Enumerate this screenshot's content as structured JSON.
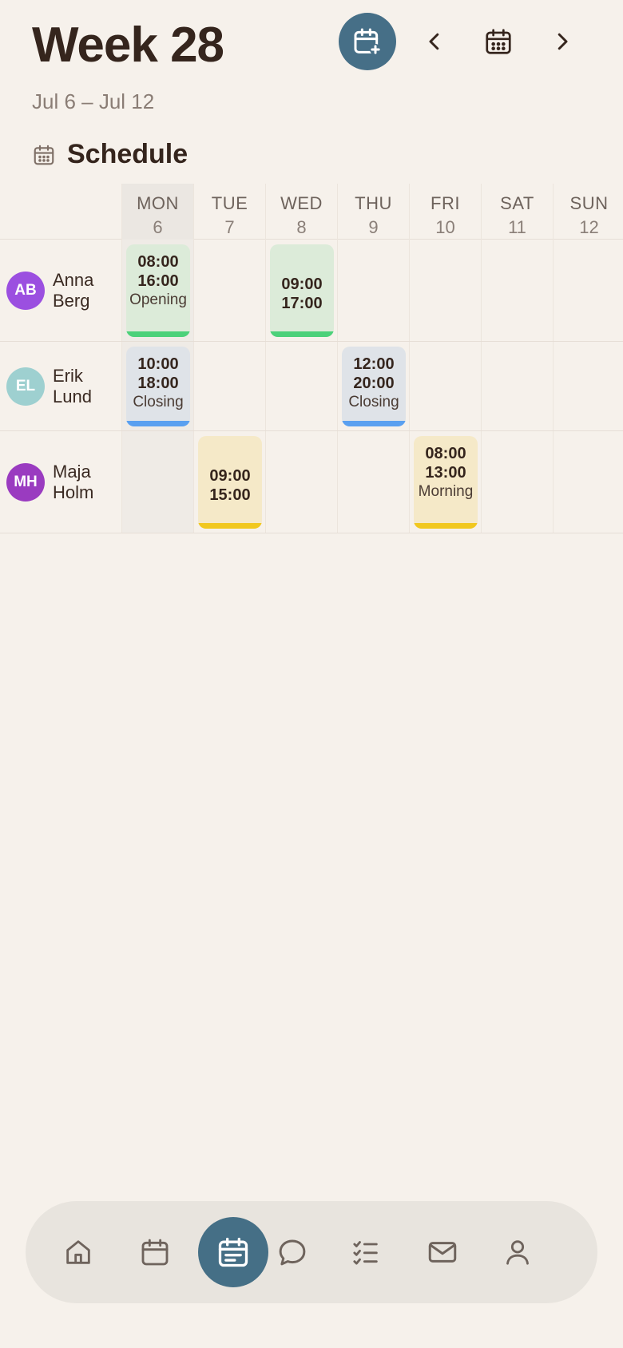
{
  "header": {
    "title": "Week 28",
    "range": "Jul 6 – Jul 12"
  },
  "actions": [
    "add-shift-icon",
    "chevron-left-icon",
    "calendar-icon",
    "chevron-right-icon"
  ],
  "section": {
    "title": "Schedule",
    "icon": "calendar-icon"
  },
  "days": [
    {
      "name": "MON",
      "num": "6",
      "active": true
    },
    {
      "name": "TUE",
      "num": "7",
      "active": false
    },
    {
      "name": "WED",
      "num": "8",
      "active": false
    },
    {
      "name": "THU",
      "num": "9",
      "active": false
    },
    {
      "name": "FRI",
      "num": "10",
      "active": false
    },
    {
      "name": "SAT",
      "num": "11",
      "active": false
    },
    {
      "name": "SUN",
      "num": "12",
      "active": false
    }
  ],
  "people": [
    {
      "initials": "AB",
      "first": "Anna",
      "last": "Berg",
      "avatar_color": "#9b4fe0",
      "shifts": [
        {
          "day": 0,
          "start": "08:00",
          "end": "16:00",
          "label": "Opening",
          "bg": "#dcebd9",
          "bar": "#4cd17a"
        },
        {
          "day": 2,
          "start": "09:00",
          "end": "17:00",
          "label": "",
          "bg": "#dcebd9",
          "bar": "#4cd17a"
        }
      ]
    },
    {
      "initials": "EL",
      "first": "Erik",
      "last": "Lund",
      "avatar_color": "#9ed0d0",
      "shifts": [
        {
          "day": 0,
          "start": "10:00",
          "end": "18:00",
          "label": "Closing",
          "bg": "#dfe3e8",
          "bar": "#5aa0f0"
        },
        {
          "day": 3,
          "start": "12:00",
          "end": "20:00",
          "label": "Closing",
          "bg": "#dfe3e8",
          "bar": "#5aa0f0"
        }
      ]
    },
    {
      "initials": "MH",
      "first": "Maja",
      "last": "Holm",
      "avatar_color": "#9a3bc0",
      "shifts": [
        {
          "day": 1,
          "start": "09:00",
          "end": "15:00",
          "label": "",
          "bg": "#f5e9c8",
          "bar": "#f1c81f"
        },
        {
          "day": 4,
          "start": "08:00",
          "end": "13:00",
          "label": "Morning",
          "bg": "#f5e9c8",
          "bar": "#f1c81f"
        }
      ]
    }
  ],
  "bottom_nav": {
    "items": [
      "home-icon",
      "calendar-icon",
      "schedule-icon",
      "chat-icon",
      "tasks-icon",
      "mail-icon",
      "profile-icon"
    ],
    "active": "schedule-icon"
  }
}
